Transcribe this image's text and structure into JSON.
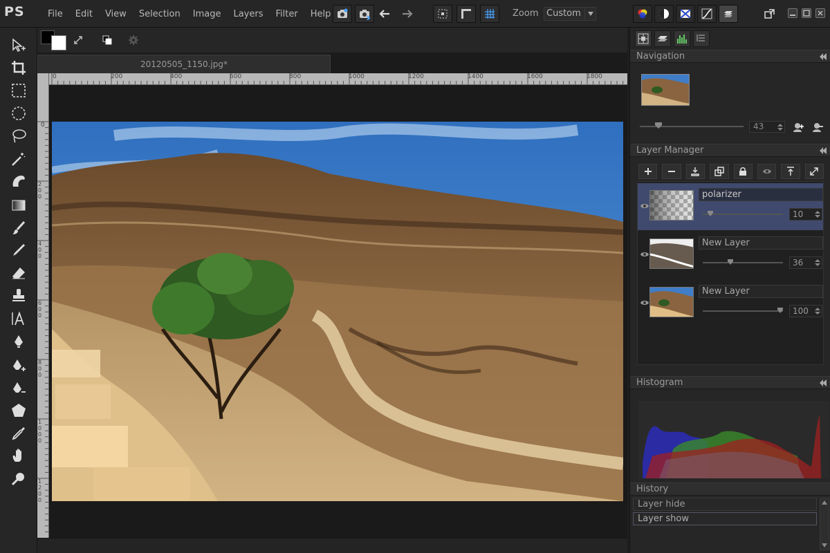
{
  "app": {
    "logo": "PS"
  },
  "menu": [
    "File",
    "Edit",
    "View",
    "Selection",
    "Image",
    "Layers",
    "Filter",
    "Help"
  ],
  "zoom": {
    "label": "Zoom",
    "value": "Custom"
  },
  "document": {
    "tab_title": "20120505_1150.jpg*"
  },
  "ruler": {
    "h_labels": [
      "0",
      "200",
      "400",
      "600",
      "800",
      "1000",
      "1200",
      "1400",
      "1600",
      "1800"
    ],
    "v_labels": [
      "0",
      "200",
      "400",
      "600",
      "800",
      "1000",
      "1200"
    ]
  },
  "panels": {
    "navigation": {
      "title": "Navigation",
      "zoom_value": "43"
    },
    "layer_manager": {
      "title": "Layer Manager",
      "layers": [
        {
          "name": "polarizer",
          "opacity": "10",
          "selected": true,
          "slider": 0.1
        },
        {
          "name": "New Layer",
          "opacity": "36",
          "selected": false,
          "slider": 0.36
        },
        {
          "name": "New Layer",
          "opacity": "100",
          "selected": false,
          "slider": 1.0
        }
      ]
    },
    "histogram": {
      "title": "Histogram"
    },
    "history": {
      "title": "History",
      "items": [
        "Layer hide",
        "Layer show"
      ]
    }
  }
}
